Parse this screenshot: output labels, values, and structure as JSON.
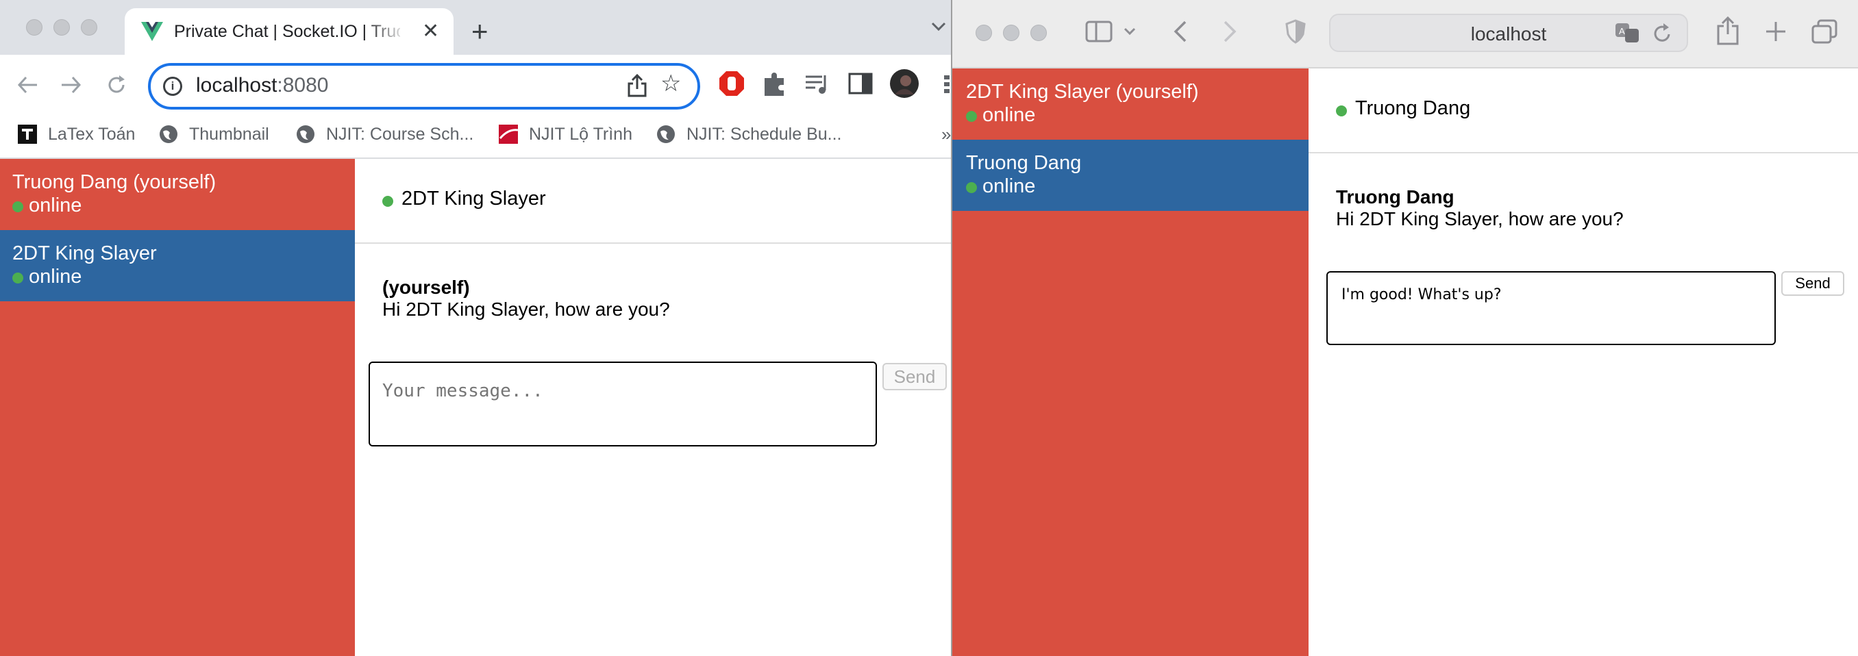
{
  "chrome": {
    "tab_title": "Private Chat | Socket.IO | Truong Dang",
    "new_tab": "+",
    "tab_close": "✕",
    "address_host": "localhost",
    "address_port": ":8080",
    "bookmarks": [
      {
        "label": "LaTex Toán",
        "icon": "T-logo-icon"
      },
      {
        "label": "Thumbnail",
        "icon": "globe-icon"
      },
      {
        "label": "NJIT: Course Sch...",
        "icon": "globe-icon"
      },
      {
        "label": "NJIT Lộ Trình",
        "icon": "njit-logo-icon"
      },
      {
        "label": "NJIT: Schedule Bu...",
        "icon": "globe-icon"
      }
    ],
    "bookmarks_more": "»"
  },
  "left_app": {
    "users": [
      {
        "name": "Truong Dang (yourself)",
        "status": "online"
      },
      {
        "name": "2DT King Slayer",
        "status": "online"
      }
    ],
    "header_name": "2DT King Slayer",
    "message": {
      "from": "(yourself)",
      "text": "Hi 2DT King Slayer, how are you?"
    },
    "input_placeholder": "Your message...",
    "input_value": "",
    "send_label": "Send"
  },
  "safari": {
    "address": "localhost"
  },
  "right_app": {
    "users": [
      {
        "name": "2DT King Slayer (yourself)",
        "status": "online"
      },
      {
        "name": "Truong Dang",
        "status": "online"
      }
    ],
    "header_name": "Truong Dang",
    "message": {
      "from": "Truong Dang",
      "text": "Hi 2DT King Slayer, how are you?"
    },
    "input_value": "I'm good! What's up?",
    "send_label": "Send"
  },
  "colors": {
    "sidebar": "#d94f40",
    "selected_user": "#2d66a0",
    "online_dot": "#4caf50",
    "chrome_focus": "#1a73e8"
  }
}
